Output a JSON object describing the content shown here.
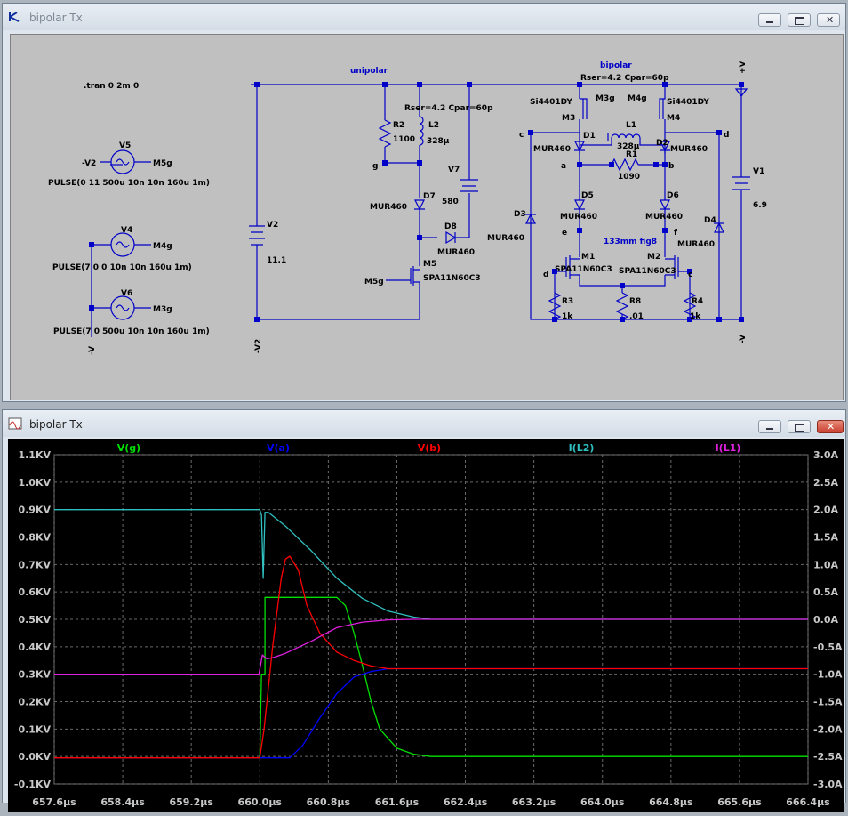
{
  "schematic_window": {
    "title": "bipolar Tx"
  },
  "waveform_window": {
    "title": "bipolar Tx"
  },
  "schematic": {
    "directive": ".tran 0 2m 0",
    "sources": [
      {
        "name": "V5",
        "left_net": "-V2",
        "right_net": "M5g",
        "spec": "PULSE(0 11 500u 10n 10n 160u 1m)"
      },
      {
        "name": "V4",
        "right_net": "M4g",
        "spec": "PULSE(7 0 0 10n 10n 160u 1m)"
      },
      {
        "name": "V6",
        "right_net": "M3g",
        "spec": "PULSE(7 0 500u 10n 10n 160u 1m)"
      }
    ],
    "left_rail_label": "-V",
    "unipolar": {
      "label": "unipolar",
      "v2": {
        "name": "V2",
        "value": "11.1",
        "bottom_label": "-V2"
      },
      "r2": {
        "name": "R2",
        "value": "1100"
      },
      "l2": {
        "name": "L2",
        "value": "328µ",
        "rser": "Rser=4.2 Cpar=60p"
      },
      "g_label": "g",
      "v7": {
        "name": "V7",
        "value": "580"
      },
      "d7": {
        "name": "D7",
        "model": "MUR460"
      },
      "d8": {
        "name": "D8",
        "model": "MUR460"
      },
      "m5": {
        "name": "M5",
        "model": "SPA11N60C3",
        "gate": "M5g"
      }
    },
    "bipolar": {
      "label": "bipolar",
      "rser": "Rser=4.2 Cpar=60p",
      "plus_v": "+V",
      "minus_v": "-V",
      "m3": {
        "name": "M3",
        "model": "Si4401DY",
        "gate": "M3g"
      },
      "m4": {
        "name": "M4",
        "model": "Si4401DY",
        "gate": "M4g"
      },
      "d1": {
        "name": "D1",
        "model": "MUR460"
      },
      "d2": {
        "name": "D2",
        "model": "MUR460"
      },
      "l1": {
        "name": "L1",
        "value": "328µ"
      },
      "r1": {
        "name": "R1",
        "value": "1090"
      },
      "node_a": "a",
      "node_b": "b",
      "node_c": "c",
      "node_d": "d",
      "node_e": "e",
      "node_f": "f",
      "d5": {
        "name": "D5",
        "model": "MUR460"
      },
      "d6": {
        "name": "D6",
        "model": "MUR460"
      },
      "d3": {
        "name": "D3",
        "model": "MUR460"
      },
      "d4": {
        "name": "D4",
        "model": "MUR460"
      },
      "fig_label": "133mm fig8",
      "m1": {
        "name": "M1",
        "model": "SPA11N60C3"
      },
      "m2": {
        "name": "M2",
        "model": "SPA11N60C3"
      },
      "r3": {
        "name": "R3",
        "value": "1k"
      },
      "r8": {
        "name": "R8",
        "value": ".01"
      },
      "r4": {
        "name": "R4",
        "value": "1k"
      },
      "v1": {
        "name": "V1",
        "value": "6.9"
      }
    }
  },
  "colors": {
    "vg": "#00e000",
    "va": "#0000ff",
    "vb": "#ff0000",
    "il2": "#30c0c0",
    "il1": "#e020e0",
    "wire": "#0000c8",
    "bg_schematic": "#c0c0c0"
  },
  "chart_data": {
    "type": "line",
    "trace_labels": [
      "V(g)",
      "V(a)",
      "V(b)",
      "I(L2)",
      "I(L1)"
    ],
    "x_ticks": [
      "657.6µs",
      "658.4µs",
      "659.2µs",
      "660.0µs",
      "660.8µs",
      "661.6µs",
      "662.4µs",
      "663.2µs",
      "664.0µs",
      "664.8µs",
      "665.6µs",
      "666.4µs"
    ],
    "left_ticks": [
      "1.1KV",
      "1.0KV",
      "0.9KV",
      "0.8KV",
      "0.7KV",
      "0.6KV",
      "0.5KV",
      "0.4KV",
      "0.3KV",
      "0.2KV",
      "0.1KV",
      "0.0KV",
      "-0.1KV"
    ],
    "right_ticks": [
      "3.0A",
      "2.5A",
      "2.0A",
      "1.5A",
      "1.0A",
      "0.5A",
      "0.0A",
      "-0.5A",
      "-1.0A",
      "-1.5A",
      "-2.0A",
      "-2.5A",
      "-3.0A"
    ],
    "xlim": [
      657.6,
      666.4
    ],
    "ylim_left": [
      -0.1,
      1.1
    ],
    "ylim_right": [
      -3.0,
      3.0
    ],
    "grid": true,
    "series": [
      {
        "name": "V(g)",
        "axis": "left",
        "color": "#00e000",
        "x": [
          657.6,
          660.0,
          660.02,
          660.06,
          660.06,
          660.9,
          661.0,
          661.1,
          661.2,
          661.3,
          661.4,
          661.6,
          661.8,
          662.0,
          666.4
        ],
        "y": [
          -0.005,
          -0.005,
          0.3,
          0.3,
          0.58,
          0.58,
          0.55,
          0.45,
          0.33,
          0.2,
          0.1,
          0.03,
          0.008,
          0.0,
          0.0
        ]
      },
      {
        "name": "V(a)",
        "axis": "left",
        "color": "#0000ff",
        "x": [
          657.6,
          660.0,
          660.1,
          660.35,
          660.5,
          660.7,
          660.9,
          661.1,
          661.3,
          661.5,
          661.8,
          666.4
        ],
        "y": [
          -0.005,
          -0.005,
          -0.005,
          -0.005,
          0.04,
          0.14,
          0.23,
          0.29,
          0.31,
          0.32,
          0.32,
          0.32
        ]
      },
      {
        "name": "V(b)",
        "axis": "left",
        "color": "#ff0000",
        "x": [
          657.6,
          660.0,
          660.05,
          660.15,
          660.25,
          660.3,
          660.35,
          660.45,
          660.55,
          660.7,
          660.9,
          661.1,
          661.3,
          661.5,
          661.8,
          666.4
        ],
        "y": [
          -0.005,
          -0.005,
          0.1,
          0.4,
          0.65,
          0.72,
          0.73,
          0.68,
          0.55,
          0.45,
          0.38,
          0.35,
          0.33,
          0.32,
          0.32,
          0.32
        ]
      },
      {
        "name": "I(L2)",
        "axis": "right",
        "color": "#30c0c0",
        "x": [
          657.6,
          660.0,
          660.02,
          660.04,
          660.06,
          660.1,
          660.3,
          660.6,
          660.9,
          661.2,
          661.5,
          661.8,
          662.0,
          666.4
        ],
        "y": [
          2.0,
          2.0,
          1.9,
          0.75,
          1.95,
          1.95,
          1.7,
          1.25,
          0.75,
          0.38,
          0.15,
          0.04,
          0.0,
          0.0
        ]
      },
      {
        "name": "I(L1)",
        "axis": "right",
        "color": "#e020e0",
        "x": [
          657.6,
          659.99,
          660.03,
          660.08,
          660.15,
          660.3,
          660.6,
          660.9,
          661.2,
          661.5,
          661.8,
          666.4
        ],
        "y": [
          -1.0,
          -1.0,
          -0.65,
          -0.72,
          -0.7,
          -0.62,
          -0.4,
          -0.15,
          -0.05,
          -0.01,
          0.0,
          0.0
        ]
      }
    ]
  }
}
